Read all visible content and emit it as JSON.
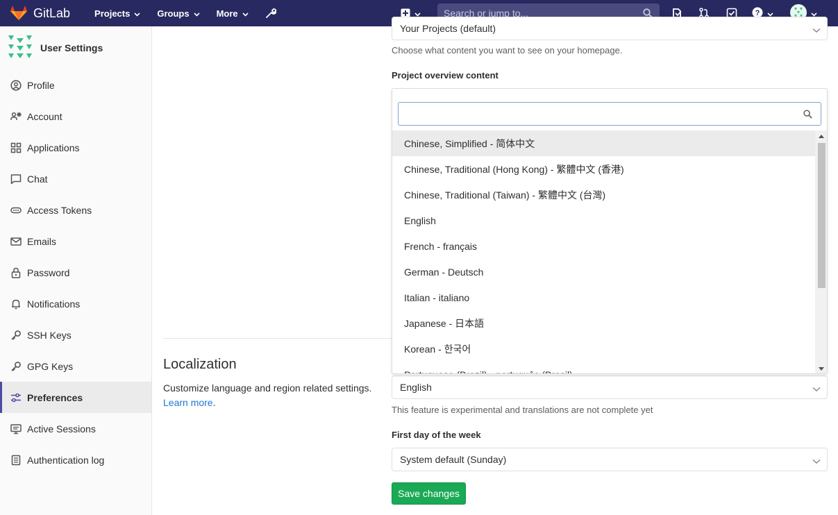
{
  "navbar": {
    "brand": "GitLab",
    "items": [
      {
        "label": "Projects"
      },
      {
        "label": "Groups"
      },
      {
        "label": "More"
      }
    ],
    "search_placeholder": "Search or jump to..."
  },
  "sidebar": {
    "title": "User Settings",
    "items": [
      {
        "label": "Profile",
        "icon": "profile-icon"
      },
      {
        "label": "Account",
        "icon": "account-icon"
      },
      {
        "label": "Applications",
        "icon": "applications-icon"
      },
      {
        "label": "Chat",
        "icon": "chat-icon"
      },
      {
        "label": "Access Tokens",
        "icon": "token-icon"
      },
      {
        "label": "Emails",
        "icon": "email-icon"
      },
      {
        "label": "Password",
        "icon": "lock-icon"
      },
      {
        "label": "Notifications",
        "icon": "bell-icon"
      },
      {
        "label": "SSH Keys",
        "icon": "key-icon"
      },
      {
        "label": "GPG Keys",
        "icon": "key-icon"
      },
      {
        "label": "Preferences",
        "icon": "preferences-icon",
        "active": true
      },
      {
        "label": "Active Sessions",
        "icon": "monitor-icon"
      },
      {
        "label": "Authentication log",
        "icon": "log-icon"
      }
    ]
  },
  "main": {
    "homepage_select": "Your Projects (default)",
    "homepage_help": "Choose what content you want to see on your homepage.",
    "project_overview_label": "Project overview content",
    "localization": {
      "title": "Localization",
      "description": "Customize language and region related settings.",
      "learn_more": "Learn more",
      "learn_more_suffix": ".",
      "language_value": "English",
      "language_help": "This feature is experimental and translations are not complete yet",
      "first_day_label": "First day of the week",
      "first_day_value": "System default (Sunday)"
    },
    "save_label": "Save changes"
  },
  "dropdown": {
    "search_value": "",
    "options": [
      "Chinese, Simplified - 简体中文",
      "Chinese, Traditional (Hong Kong) - 繁體中文 (香港)",
      "Chinese, Traditional (Taiwan) - 繁體中文 (台灣)",
      "English",
      "French - français",
      "German - Deutsch",
      "Italian - italiano",
      "Japanese - 日本語",
      "Korean - 한국어",
      "Portuguese (Brazil) - português (Brasil)"
    ],
    "highlighted_index": 0
  },
  "colors": {
    "navbar": "#292961",
    "accent": "#4b4ba3",
    "save_button": "#1aaa55",
    "link": "#1f78d1"
  }
}
